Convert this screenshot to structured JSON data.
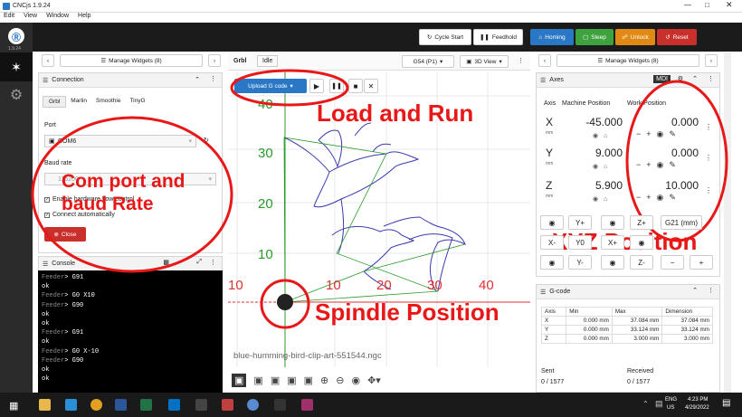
{
  "app": {
    "title": "CNCjs 1.9.24",
    "version": "1.9.24",
    "menu": [
      "Edit",
      "View",
      "Window",
      "Help"
    ]
  },
  "toolbar": {
    "cycle_start": "Cycle Start",
    "feedhold": "Feedhold",
    "homing": "Homing",
    "sleep": "Sleep",
    "unlock": "Unlock",
    "reset": "Reset"
  },
  "left": {
    "manage_widgets": "Manage Widgets (8)",
    "connection": {
      "title": "Connection",
      "tabs": [
        "Grbl",
        "Marlin",
        "Smoothie",
        "TinyG"
      ],
      "port_label": "Port",
      "port_value": "COM6",
      "baud_label": "Baud rate",
      "baud_value": "115200",
      "flow_control": "Enable hardware flow control",
      "connect_auto": "Connect automatically",
      "close_button": "Close"
    },
    "console": {
      "title": "Console",
      "lines": [
        {
          "p": "Feeder",
          "t": "> G91"
        },
        {
          "p": "",
          "t": "ok"
        },
        {
          "p": "Feeder",
          "t": "> G0 X10"
        },
        {
          "p": "Feeder",
          "t": "> G90"
        },
        {
          "p": "",
          "t": "ok"
        },
        {
          "p": "",
          "t": "ok"
        },
        {
          "p": "Feeder",
          "t": "> G91"
        },
        {
          "p": "",
          "t": "ok"
        },
        {
          "p": "Feeder",
          "t": "> G0 X-10"
        },
        {
          "p": "Feeder",
          "t": "> G90"
        },
        {
          "p": "",
          "t": "ok"
        },
        {
          "p": "",
          "t": "ok"
        }
      ]
    }
  },
  "center": {
    "tab": "Grbl",
    "state": "Idle",
    "wcs": "G54 (P1)",
    "view": "3D View",
    "upload": "Upload G code",
    "filename": "blue-humming-bird-clip-art-551544.ngc",
    "y_ticks": [
      "40",
      "30",
      "20",
      "10"
    ],
    "x_ticks": [
      "10",
      "10",
      "20",
      "30",
      "40"
    ]
  },
  "right": {
    "manage_widgets": "Manage Widgets (8)",
    "axes": {
      "title": "Axes",
      "mdi": "MDI",
      "col_machine": "Machine Position",
      "col_work": "Work Position",
      "unit": "mm",
      "rows": [
        {
          "axis": "X",
          "machine": "-45.000",
          "work": "0.000"
        },
        {
          "axis": "Y",
          "machine": "9.000",
          "work": "0.000"
        },
        {
          "axis": "Z",
          "machine": "5.900",
          "work": "10.000"
        }
      ],
      "jog": [
        "Y+",
        "Z+",
        "G21 (mm)",
        "X-",
        "Y0",
        "X+",
        "Y-",
        "Z-"
      ]
    },
    "gcode": {
      "title": "G-code",
      "headers": [
        "Axis",
        "Min",
        "Max",
        "Dimension"
      ],
      "rows": [
        [
          "X",
          "0.000 mm",
          "37.084 mm",
          "37.084 mm"
        ],
        [
          "Y",
          "0.000 mm",
          "33.124 mm",
          "33.124 mm"
        ],
        [
          "Z",
          "0.000 mm",
          "3.000 mm",
          "3.000 mm"
        ]
      ],
      "sent_label": "Sent",
      "sent_value": "0 / 1577",
      "received_label": "Received",
      "received_value": "0 / 1577"
    }
  },
  "annotations": {
    "load_run": "Load and Run",
    "com_port": "Com port and baud Rate",
    "xyz": "XYZ Position",
    "spindle": "Spindle Position"
  },
  "taskbar": {
    "lang": "ENG",
    "region": "US",
    "time": "4:23 PM",
    "date": "4/29/2022"
  }
}
